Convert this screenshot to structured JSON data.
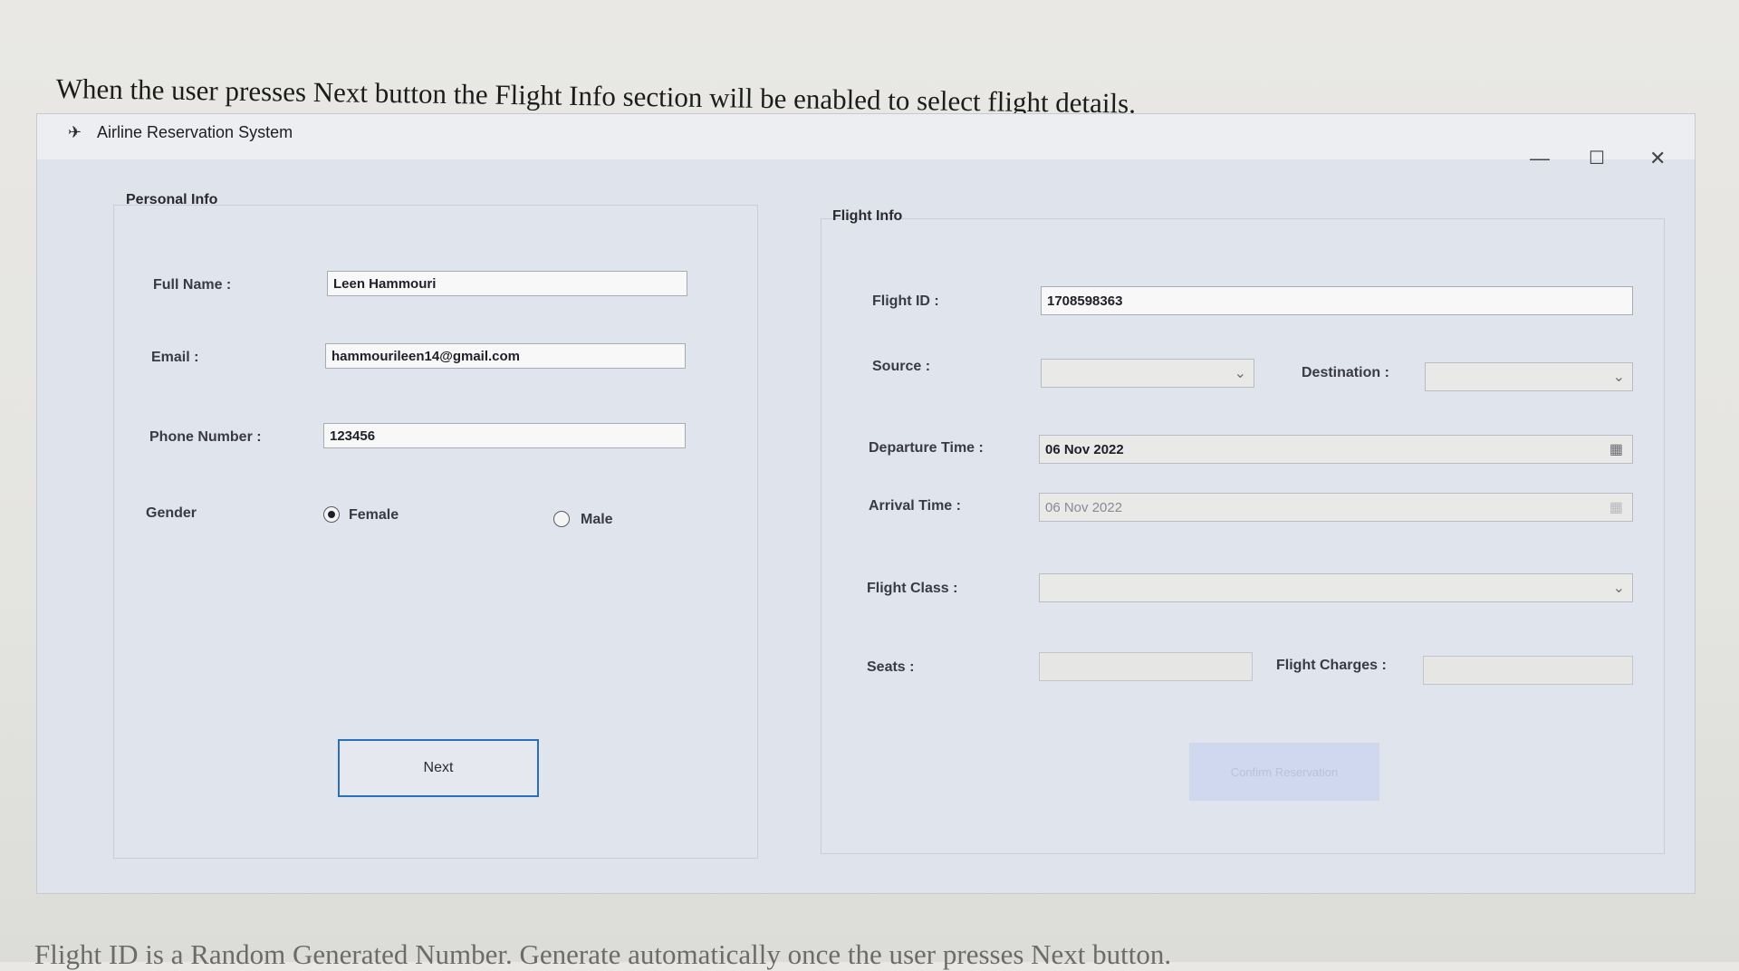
{
  "doc": {
    "top_text": "When the user presses Next button the Flight Info section will be enabled to select flight details.",
    "bottom_text": "Flight ID is a Random Generated Number. Generate automatically once the user presses Next button."
  },
  "window": {
    "title": "Airline Reservation System",
    "minimize": "—",
    "maximize": "☐",
    "close": "✕"
  },
  "personal": {
    "title": "Personal Info",
    "full_name_label": "Full Name :",
    "full_name_value": "Leen Hammouri",
    "email_label": "Email :",
    "email_value": "hammourileen14@gmail.com",
    "phone_label": "Phone Number :",
    "phone_value": "123456",
    "gender_label": "Gender",
    "female_label": "Female",
    "male_label": "Male",
    "next_label": "Next"
  },
  "flight": {
    "title": "Flight Info",
    "id_label": "Flight ID :",
    "id_value": "1708598363",
    "source_label": "Source :",
    "destination_label": "Destination :",
    "departure_label": "Departure Time :",
    "departure_value": "06 Nov 2022",
    "arrival_label": "Arrival Time :",
    "arrival_value": "06 Nov 2022",
    "class_label": "Flight Class :",
    "seats_label": "Seats :",
    "charges_label": "Flight Charges :",
    "confirm_label": "Confirm Reservation"
  },
  "icons": {
    "plane": "✈",
    "chevron": "⌄",
    "calendar": "▦"
  }
}
